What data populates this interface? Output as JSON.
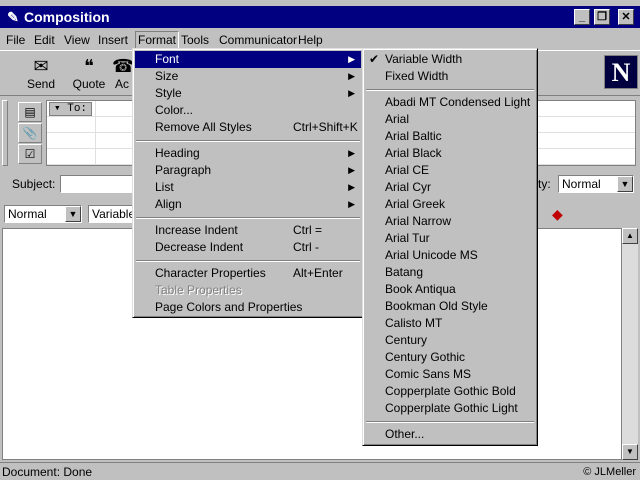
{
  "window": {
    "title": "Composition",
    "minimize": "_",
    "maximize": "❐",
    "close": "✕"
  },
  "menubar": [
    "File",
    "Edit",
    "View",
    "Insert",
    "Format",
    "Tools",
    "Communicator",
    "Help"
  ],
  "toolbar": {
    "send": "Send",
    "quote": "Quote",
    "address": "Ac"
  },
  "address": {
    "to_label": "To:"
  },
  "subject": {
    "label": "Subject:",
    "priority_label": "ty:",
    "priority_value": "Normal"
  },
  "format_bar": {
    "paragraph_style": "Normal",
    "font_name": "Variable"
  },
  "format_menu": {
    "items": [
      {
        "label": "Font",
        "shortcut": "",
        "submenu": true
      },
      {
        "label": "Size",
        "shortcut": "",
        "submenu": true
      },
      {
        "label": "Style",
        "shortcut": "",
        "submenu": true
      },
      {
        "label": "Color...",
        "shortcut": "",
        "submenu": false
      },
      {
        "label": "Remove All Styles",
        "shortcut": "Ctrl+Shift+K",
        "submenu": false
      },
      {
        "label": "Heading",
        "shortcut": "",
        "submenu": true
      },
      {
        "label": "Paragraph",
        "shortcut": "",
        "submenu": true
      },
      {
        "label": "List",
        "shortcut": "",
        "submenu": true
      },
      {
        "label": "Align",
        "shortcut": "",
        "submenu": true
      },
      {
        "label": "Increase Indent",
        "shortcut": "Ctrl =",
        "submenu": false
      },
      {
        "label": "Decrease Indent",
        "shortcut": "Ctrl -",
        "submenu": false
      },
      {
        "label": "Character Properties",
        "shortcut": "Alt+Enter",
        "submenu": false
      },
      {
        "label": "Table Properties",
        "shortcut": "",
        "submenu": false
      },
      {
        "label": "Page Colors and Properties",
        "shortcut": "",
        "submenu": false
      }
    ]
  },
  "font_menu": {
    "items": [
      "Variable Width",
      "Fixed Width",
      "Abadi MT Condensed Light",
      "Arial",
      "Arial Baltic",
      "Arial Black",
      "Arial CE",
      "Arial Cyr",
      "Arial Greek",
      "Arial Narrow",
      "Arial Tur",
      "Arial Unicode MS",
      "Batang",
      "Book Antiqua",
      "Bookman Old Style",
      "Calisto MT",
      "Century",
      "Century Gothic",
      "Comic Sans MS",
      "Copperplate Gothic Bold",
      "Copperplate Gothic Light",
      "Other..."
    ]
  },
  "status": {
    "text": "Document: Done",
    "credit": "© JLMeller"
  },
  "logo": "N"
}
